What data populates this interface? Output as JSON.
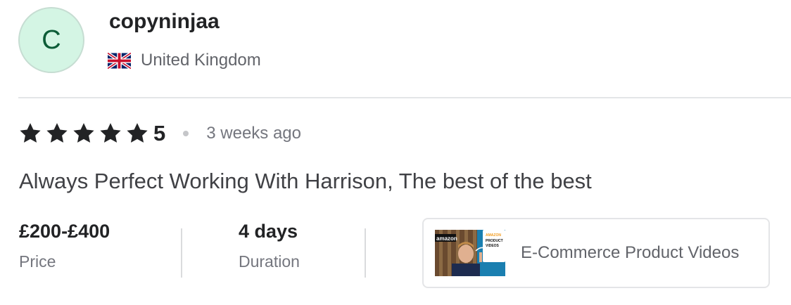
{
  "reviewer": {
    "avatar_initial": "C",
    "username": "copyninjaa",
    "country": "United Kingdom",
    "flag_icon": "uk-flag-icon"
  },
  "review": {
    "rating": 5,
    "rating_label": "5",
    "time_ago": "3 weeks ago",
    "text": "Always Perfect Working With Harrison, The best of the best"
  },
  "order": {
    "price_value": "£200-£400",
    "price_label": "Price",
    "duration_value": "4 days",
    "duration_label": "Duration"
  },
  "gig": {
    "title": "E-Commerce Product Videos",
    "thumbnail_texts": [
      "amazon",
      "AMAZON",
      "PRODUCT",
      "VIDEOS"
    ]
  },
  "colors": {
    "avatar_bg": "#d4f5e4",
    "avatar_text": "#0c5c37",
    "star": "#222325",
    "muted_text": "#74767e"
  }
}
